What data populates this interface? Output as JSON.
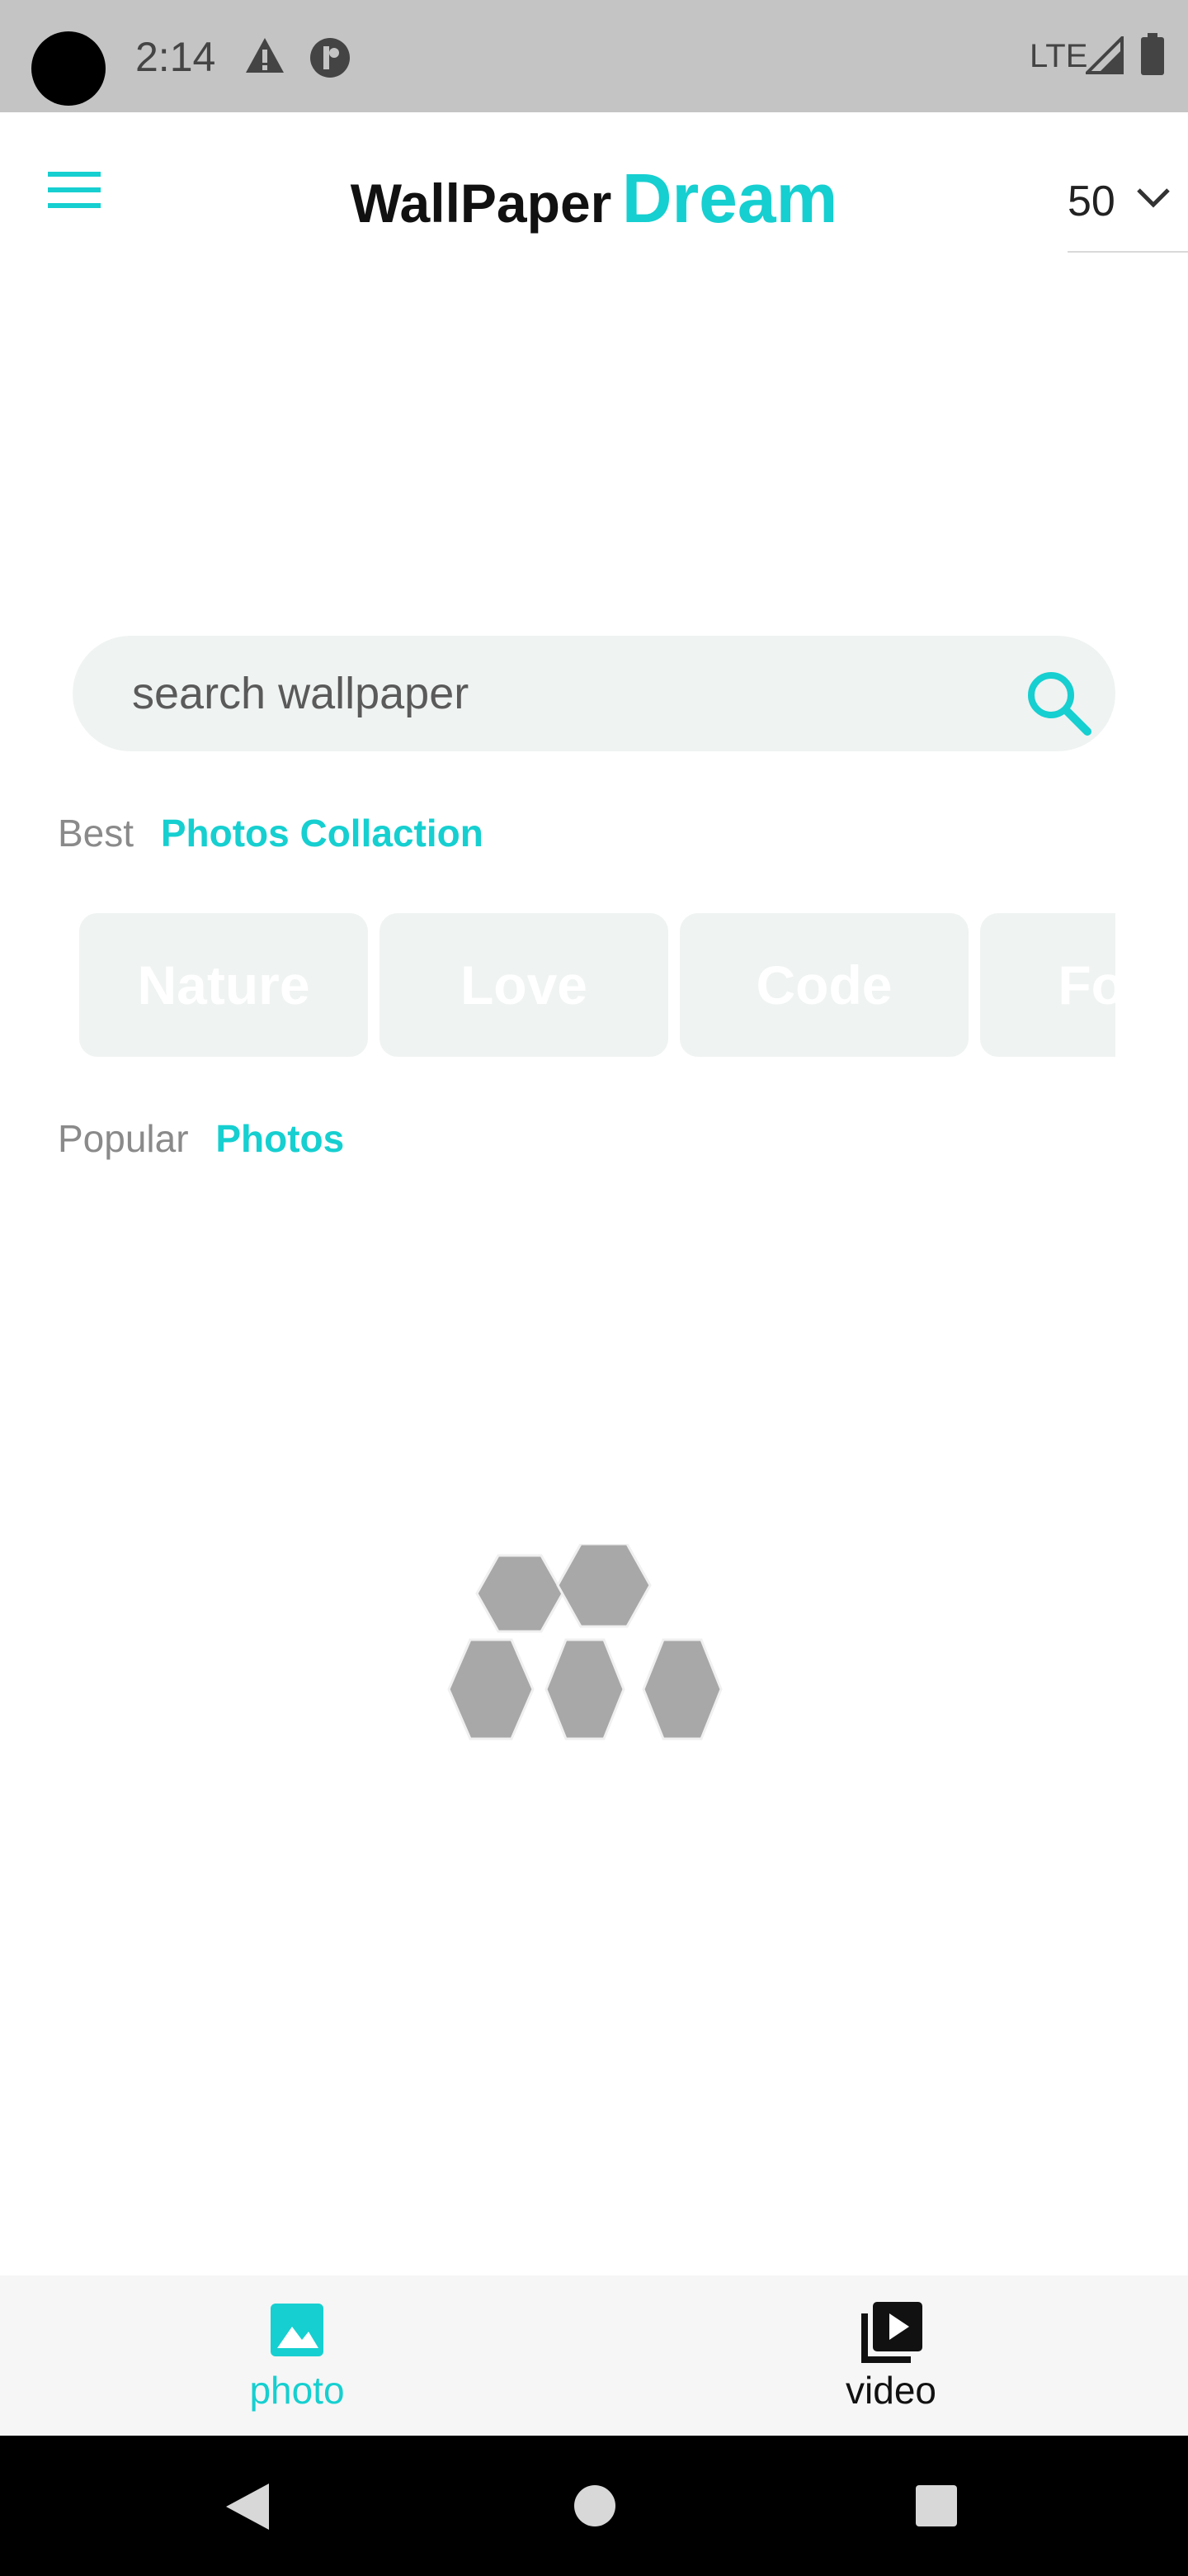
{
  "status_bar": {
    "time": "2:14",
    "network": "LTE"
  },
  "app_bar": {
    "title_part1": "WallPaper",
    "title_part2": "Dream",
    "per_page_value": "50"
  },
  "search": {
    "placeholder": "search wallpaper"
  },
  "best_section": {
    "label_muted": "Best",
    "label_accent": "Photos Collaction"
  },
  "categories": [
    {
      "label": "Nature"
    },
    {
      "label": "Love"
    },
    {
      "label": "Code"
    },
    {
      "label": "Food"
    }
  ],
  "popular_section": {
    "label_muted": "Popular",
    "label_accent": "Photos"
  },
  "bottom_nav": {
    "photo_label": "photo",
    "video_label": "video"
  },
  "colors": {
    "accent": "#16cfd0",
    "chip_bg": "#eff3f2",
    "status_bar_bg": "#c4c4c4"
  },
  "icons": {
    "menu": "menu-icon",
    "search": "search-icon",
    "photo": "image-icon",
    "video": "video-library-icon"
  }
}
